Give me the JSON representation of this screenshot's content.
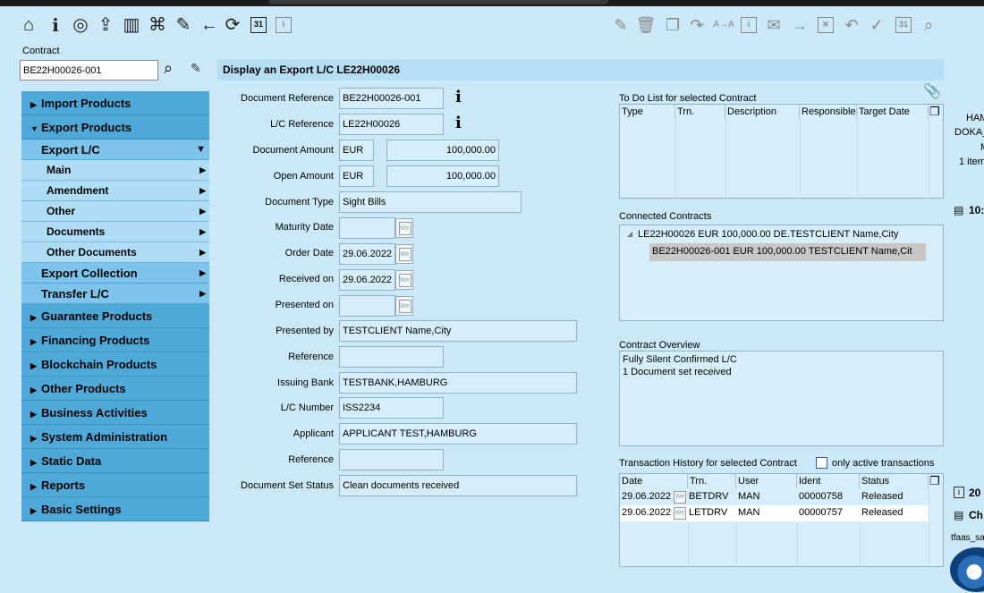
{
  "toolbar": {
    "left_icons": [
      "home-icon",
      "info-icon",
      "target-icon",
      "routing-icon",
      "book-icon",
      "network-icon",
      "edit-icon",
      "back-arrow-icon",
      "refresh-icon",
      "calendar-icon",
      "info-box-icon"
    ],
    "right_icons": [
      "edit-disabled-icon",
      "trash-icon",
      "copy-doc-icon",
      "forward-icon",
      "swap-icon",
      "info-box-icon",
      "mail-icon",
      "arrow-right-icon",
      "cancel-box-icon",
      "undo-icon",
      "check-icon",
      "calendar-icon",
      "search-icon"
    ],
    "calendar_label": "31"
  },
  "contract": {
    "label": "Contract",
    "value": "BE22H00026-001"
  },
  "page_title": "Display an Export L/C LE22H00026",
  "nav": {
    "import_products": "Import Products",
    "export_products": "Export Products",
    "export_lc": "Export L/C",
    "main": "Main",
    "amendment": "Amendment",
    "other": "Other",
    "documents": "Documents",
    "other_documents": "Other Documents",
    "export_collection": "Export Collection",
    "transfer_lc": "Transfer L/C",
    "guarantee_products": "Guarantee Products",
    "financing_products": "Financing Products",
    "blockchain_products": "Blockchain Products",
    "other_products": "Other Products",
    "business_activities": "Business Activities",
    "system_administration": "System Administration",
    "static_data": "Static Data",
    "reports": "Reports",
    "basic_settings": "Basic Settings"
  },
  "form": {
    "document_reference": {
      "label": "Document Reference",
      "value": "BE22H00026-001"
    },
    "lc_reference": {
      "label": "L/C Reference",
      "value": "LE22H00026"
    },
    "document_amount": {
      "label": "Document Amount",
      "currency": "EUR",
      "value": "100,000.00"
    },
    "open_amount": {
      "label": "Open Amount",
      "currency": "EUR",
      "value": "100,000.00"
    },
    "document_type": {
      "label": "Document Type",
      "value": "Sight Bills"
    },
    "maturity_date": {
      "label": "Maturity Date",
      "value": ""
    },
    "order_date": {
      "label": "Order Date",
      "value": "29.06.2022"
    },
    "received_on": {
      "label": "Received on",
      "value": "29.06.2022"
    },
    "presented_on": {
      "label": "Presented on",
      "value": ""
    },
    "presented_by": {
      "label": "Presented by",
      "value": "TESTCLIENT Name,City"
    },
    "reference1": {
      "label": "Reference",
      "value": ""
    },
    "issuing_bank": {
      "label": "Issuing Bank",
      "value": "TESTBANK,HAMBURG"
    },
    "lc_number": {
      "label": "L/C Number",
      "value": "ISS2234"
    },
    "applicant": {
      "label": "Applicant",
      "value": "APPLICANT TEST,HAMBURG"
    },
    "reference2": {
      "label": "Reference",
      "value": ""
    },
    "document_set_status": {
      "label": "Document Set Status",
      "value": "Clean documents received"
    }
  },
  "todo": {
    "title": "To Do List for selected Contract",
    "columns": [
      "Type",
      "Trn.",
      "Description",
      "Responsible",
      "Target Date"
    ]
  },
  "connected": {
    "title": "Connected Contracts",
    "parent": "LE22H00026 EUR 100,000.00 DE.TESTCLIENT Name,City",
    "child": "BE22H00026-001 EUR 100,000.00 TESTCLIENT Name,Cit"
  },
  "overview": {
    "title": "Contract Overview",
    "line1": "Fully Silent Confirmed L/C",
    "line2": "1 Document set received"
  },
  "history": {
    "title": "Transaction History for selected Contract",
    "only_active_label": "only active transactions",
    "columns": [
      "Date",
      "Trn.",
      "User",
      "Ident",
      "Status"
    ],
    "rows": [
      {
        "date": "29.06.2022",
        "trn": "BETDRV",
        "user": "MAN",
        "ident": "00000758",
        "status": "Released"
      },
      {
        "date": "29.06.2022",
        "trn": "LETDRV",
        "user": "MAN",
        "ident": "00000757",
        "status": "Released"
      }
    ]
  },
  "right_edge": {
    "t1": "HAM",
    "t2": "DOKA_",
    "t3": "M",
    "t4": "1 item",
    "t5": "10:",
    "t6": "20",
    "t7": "Ch",
    "t8": "tfaas_sa"
  },
  "colors": {
    "background": "#cbe8f8",
    "nav_main": "#4ea9d9",
    "nav_sub": "#7dc4ec",
    "nav_sub2": "#aedcf5",
    "field_bg": "#d6eefb"
  }
}
